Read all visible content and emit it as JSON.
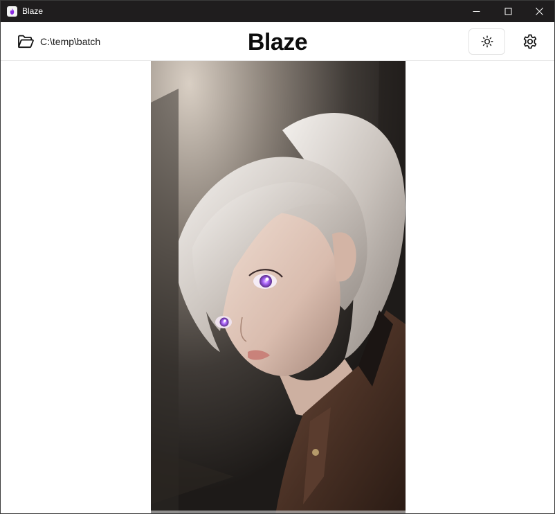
{
  "window": {
    "title": "Blaze",
    "controls": [
      "minimize-icon",
      "maximize-icon",
      "close-icon"
    ]
  },
  "header": {
    "folder_icon": "folder-open-icon",
    "folder_path": "C:\\temp\\batch",
    "brand": "Blaze",
    "theme_icon": "sun-icon",
    "settings_icon": "gear-icon"
  },
  "viewer": {
    "image_subject": "portrait-illustration"
  },
  "colors": {
    "titlebar": "#1f1d1e",
    "accent_eye": "#b06cff",
    "brand_text": "#0d0d0d"
  }
}
